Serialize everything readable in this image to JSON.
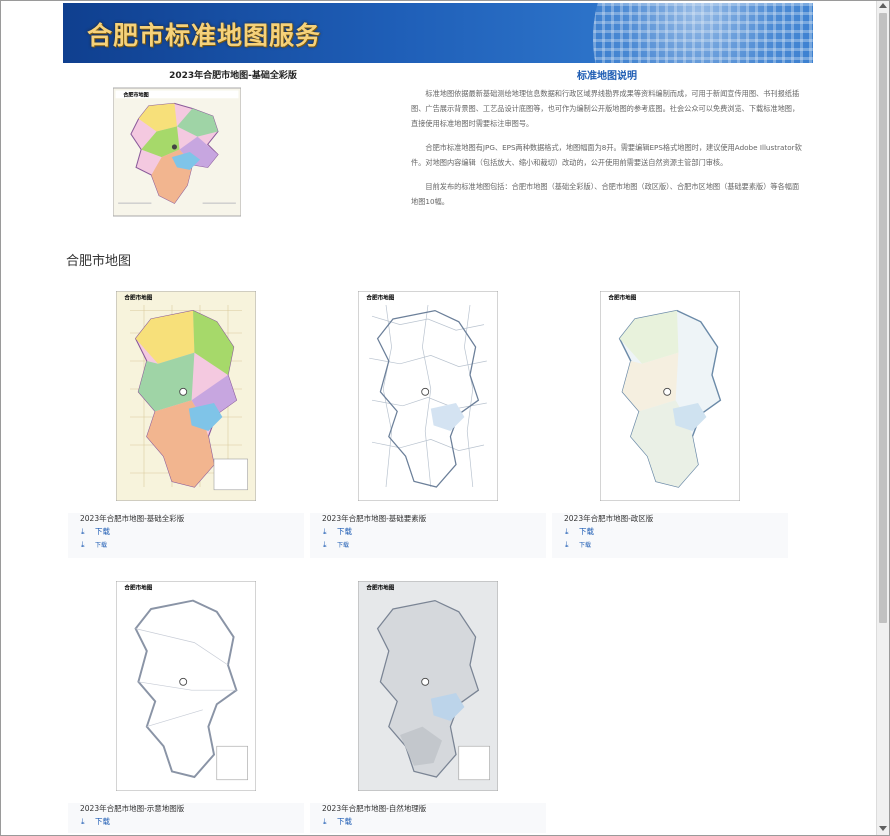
{
  "banner": {
    "title": "合肥市标准地图服务"
  },
  "feature": {
    "title": "2023年合肥市地图-基础全彩版"
  },
  "description": {
    "heading": "标准地图说明",
    "paragraphs": [
      "标准地图依据最新基础测绘地理信息数据和行政区域界线勘界成果等资料编制而成，可用于新闻宣传用图、书刊报纸插图、广告展示背景图、工艺品设计底图等，也可作为编制公开版地图的参考底图。社会公众可以免费浏览、下载标准地图，直接使用标准地图时需要标注审图号。",
      "合肥市标准地图有JPG、EPS两种数据格式，地图幅面为8开。需要编辑EPS格式地图时，建议使用Adobe Illustrator软件。对地图内容编辑（包括放大、缩小和裁切）改动的，公开使用前需要送自然资源主管部门审核。",
      "目前发布的标准地图包括：合肥市地图（基础全彩版）、合肥市地图（政区版）、合肥市区地图（基础要素版）等各幅面地图10幅。"
    ]
  },
  "section": {
    "title": "合肥市地图"
  },
  "map_header_text": "合肥市地图",
  "cards": [
    {
      "name": "2023年合肥市地图-基础全彩版",
      "download": "下载",
      "extra": "下载"
    },
    {
      "name": "2023年合肥市地图-基础要素版",
      "download": "下载",
      "extra": "下载"
    },
    {
      "name": "2023年合肥市地图-政区版",
      "download": "下载",
      "extra": "下载"
    },
    {
      "name": "2023年合肥市地图-示意地图版",
      "download": "下载"
    },
    {
      "name": "2023年合肥市地图-自然地理版",
      "download": "下载"
    }
  ],
  "icons": {
    "download": "download-icon"
  },
  "colors": {
    "accent": "#1c5bb3",
    "banner_text": "#f6d27a",
    "banner_bg": "#0f3f8f"
  }
}
